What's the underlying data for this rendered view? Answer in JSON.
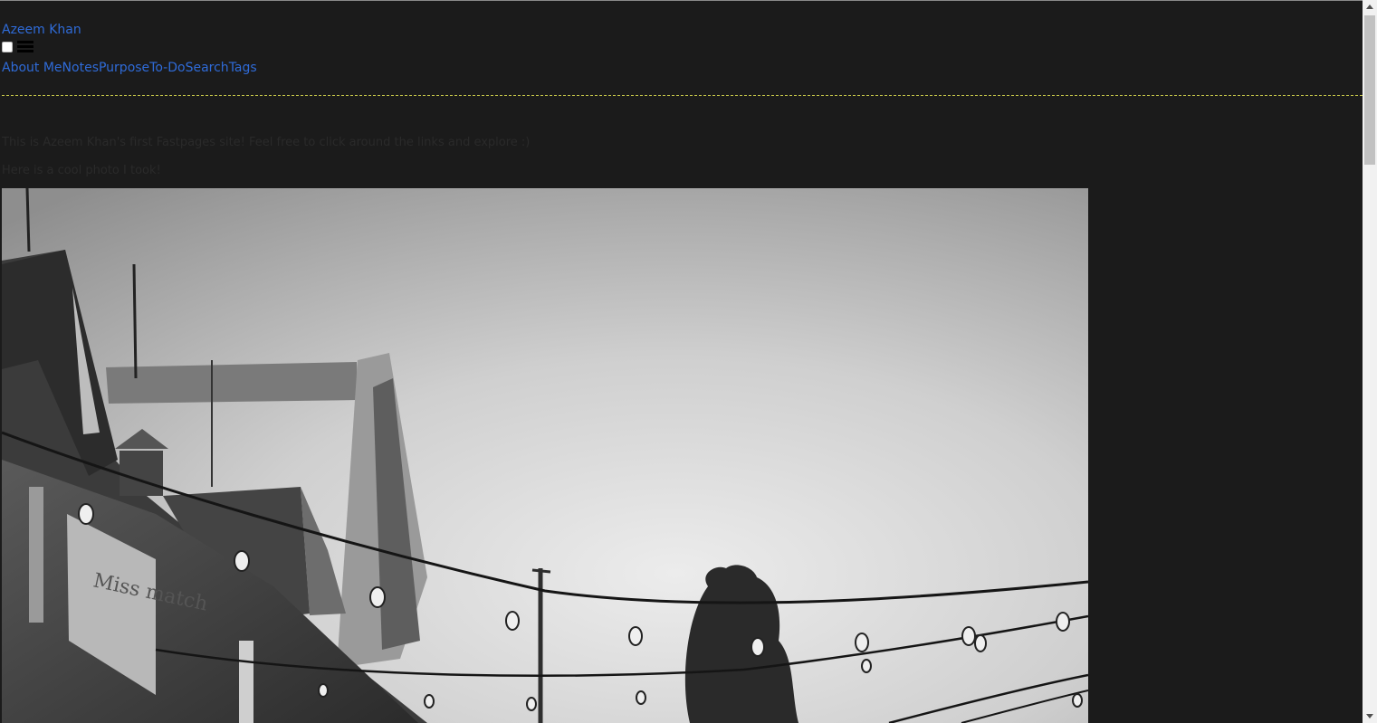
{
  "site": {
    "title": "Azeem Khan"
  },
  "nav": {
    "links": [
      {
        "label": "About Me"
      },
      {
        "label": "Notes"
      },
      {
        "label": "Purpose"
      },
      {
        "label": "To-Do"
      },
      {
        "label": "Search"
      },
      {
        "label": "Tags"
      }
    ]
  },
  "content": {
    "intro": "This is Azeem Khan's first Fastpages site! Feel free to click around the links and explore :)",
    "photo_caption": "Here is a cool photo I took!"
  },
  "photo": {
    "shop_sign": "Miss match"
  },
  "colors": {
    "background": "#1b1b1b",
    "link": "#2f6bd8",
    "divider": "#c9c94a"
  },
  "icons": [
    "hamburger-icon",
    "nav-toggle-checkbox"
  ]
}
